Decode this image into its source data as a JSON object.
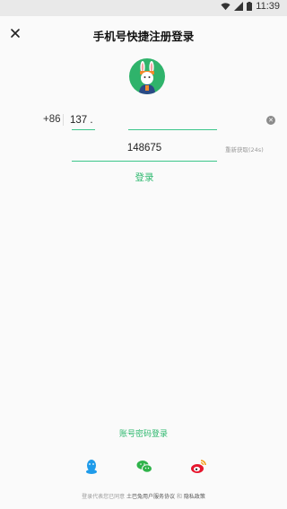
{
  "status_bar": {
    "time": "11:39"
  },
  "header": {
    "title": "手机号快捷注册登录"
  },
  "avatar": {
    "icon": "bunny-mascot-icon",
    "bg_color": "#2fb36b"
  },
  "phone": {
    "country_code": "+86",
    "value": "137 ."
  },
  "verification": {
    "value": "148675",
    "resend_label": "重新获取(24s)"
  },
  "actions": {
    "login_label": "登录",
    "account_login_label": "账号密码登录"
  },
  "social": [
    {
      "name": "qq-icon",
      "color": "#1e9bea"
    },
    {
      "name": "wechat-icon",
      "color": "#2fb34a"
    },
    {
      "name": "weibo-icon",
      "color": "#e6162d"
    }
  ],
  "footer": {
    "prefix": "登录代表您已同意",
    "terms_label": "土巴兔用户服务协议",
    "joiner": "和",
    "privacy_label": "隐私政策"
  },
  "colors": {
    "accent": "#3cc68a",
    "link": "#2db86e"
  }
}
